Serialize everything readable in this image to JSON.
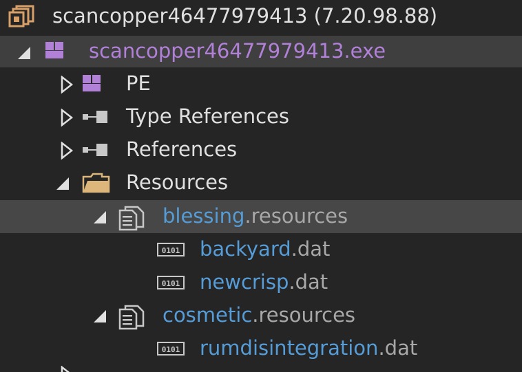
{
  "assembly": {
    "name": "scancopper46477979413",
    "version": "(7.20.98.88)"
  },
  "module": {
    "name": "scancopper46477979413.exe"
  },
  "nodes": {
    "pe": "PE",
    "type_refs": "Type References",
    "refs": "References",
    "resources": "Resources"
  },
  "resource_files": [
    {
      "name": "blessing",
      "ext": ".resources",
      "children": [
        {
          "name": "backyard",
          "ext": ".dat"
        },
        {
          "name": "newcrisp",
          "ext": ".dat"
        }
      ]
    },
    {
      "name": "cosmetic",
      "ext": ".resources",
      "children": [
        {
          "name": "rumdisintegration",
          "ext": ".dat"
        }
      ]
    }
  ],
  "icons": {
    "assembly": "assembly-icon",
    "module": "module-icon",
    "reference": "reference-icon",
    "folder": "folder-icon",
    "resource_file": "resource-file-icon",
    "binary": "binary-data-icon"
  },
  "colors": {
    "background": "#252526",
    "selected_row": "#474747",
    "module_text": "#b180d7",
    "type_text": "#569cd6",
    "folder_icon": "#dcb67a",
    "assembly_icon": "#d7a068"
  }
}
